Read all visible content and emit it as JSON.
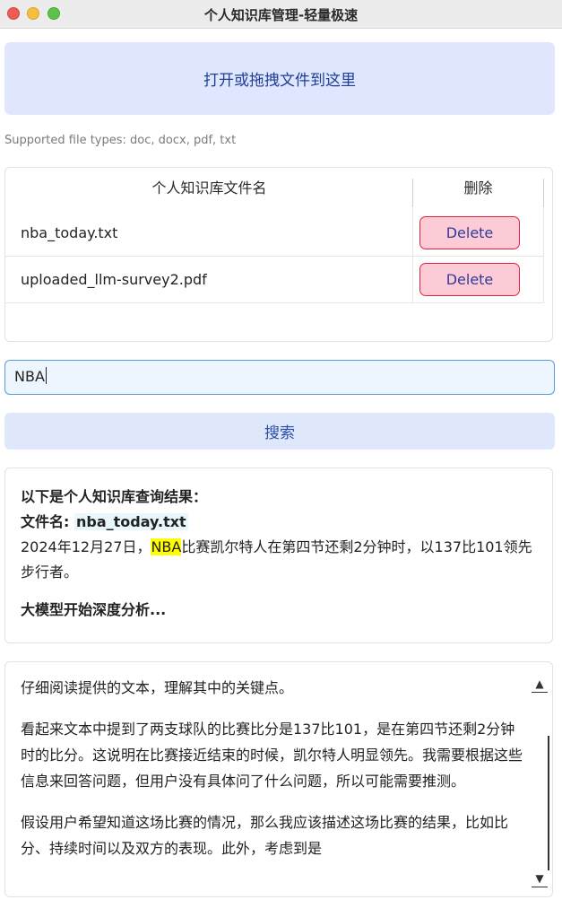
{
  "window": {
    "title": "个人知识库管理-轻量极速"
  },
  "upload": {
    "dropzone_label": "打开或拖拽文件到这里",
    "supported_types": "Supported file types: doc, docx, pdf, txt"
  },
  "files_table": {
    "headers": {
      "name": "个人知识库文件名",
      "delete": "删除"
    },
    "rows": [
      {
        "name": "nba_today.txt",
        "action": "Delete"
      },
      {
        "name": "uploaded_llm-survey2.pdf",
        "action": "Delete"
      }
    ]
  },
  "search": {
    "query": "NBA",
    "button_label": "搜索"
  },
  "result": {
    "header": "以下是个人知识库查询结果：",
    "file_label": "文件名: ",
    "file_name": "nba_today.txt",
    "content_before": "2024年12月27日，",
    "content_highlight": "NBA",
    "content_after": "比赛凯尔特人在第四节还剩2分钟时，以137比101领先步行者。",
    "deep_analysis": "大模型开始深度分析..."
  },
  "analysis": {
    "paragraphs": [
      "仔细阅读提供的文本，理解其中的关键点。",
      "看起来文本中提到了两支球队的比赛比分是137比101，是在第四节还剩2分钟时的比分。这说明在比赛接近结束的时候，凯尔特人明显领先。我需要根据这些信息来回答问题，但用户没有具体问了什么问题，所以可能需要推测。",
      "假设用户希望知道这场比赛的情况，那么我应该描述这场比赛的结果，比如比分、持续时间以及双方的表现。此外，考虑到是"
    ]
  },
  "colors": {
    "dropzone_bg": "#dfe6fd",
    "delete_bg": "#fccbd5",
    "delete_border": "#e0233b",
    "search_border": "#5d9bd8",
    "highlight": "#ffff00"
  }
}
